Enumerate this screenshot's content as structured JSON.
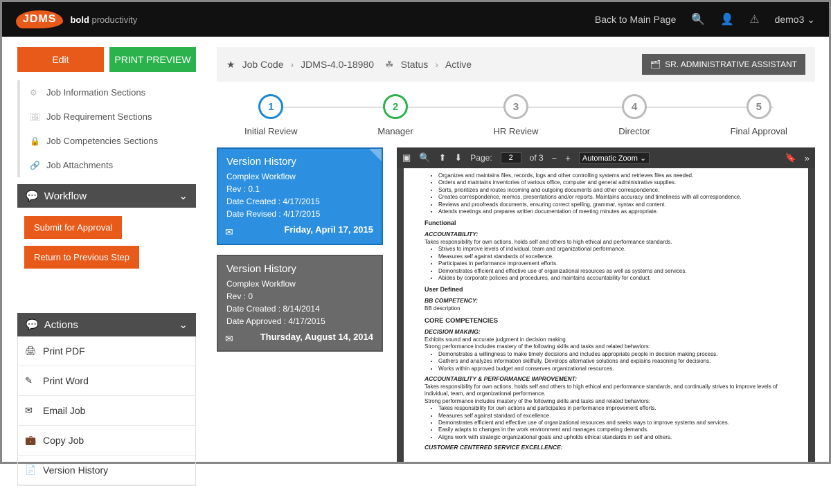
{
  "topbar": {
    "logo": "JDMS",
    "tagline_bold": "bold",
    "tagline_rest": " productivity",
    "back_link": "Back to Main Page",
    "user": "demo3"
  },
  "sidebar": {
    "edit": "Edit",
    "print_preview": "PRINT PREVIEW",
    "nav": [
      {
        "icon": "⚙",
        "label": "Job Information Sections"
      },
      {
        "icon": "🖼",
        "label": "Job Requirement Sections"
      },
      {
        "icon": "🔒",
        "label": "Job Competencies Sections"
      },
      {
        "icon": "🔗",
        "label": "Job Attachments"
      }
    ],
    "workflow": {
      "title": "Workflow",
      "submit": "Submit for Approval",
      "return": "Return to Previous Step"
    },
    "actions": {
      "title": "Actions",
      "items": [
        {
          "icon": "🖨",
          "label": "Print PDF"
        },
        {
          "icon": "✎",
          "label": "Print Word"
        },
        {
          "icon": "✉",
          "label": "Email Job"
        },
        {
          "icon": "💼",
          "label": "Copy Job"
        },
        {
          "icon": "📄",
          "label": "Version History"
        }
      ]
    }
  },
  "breadcrumb": {
    "jobcode_label": "Job Code",
    "jobcode": "JDMS-4.0-18980",
    "status_label": "Status",
    "status": "Active",
    "badge": "SR. ADMINISTRATIVE ASSISTANT"
  },
  "steps": [
    {
      "num": "1",
      "label": "Initial Review",
      "cls": "blue"
    },
    {
      "num": "2",
      "label": "Manager",
      "cls": "green"
    },
    {
      "num": "3",
      "label": "HR Review",
      "cls": ""
    },
    {
      "num": "4",
      "label": "Director",
      "cls": ""
    },
    {
      "num": "5",
      "label": "Final Approval",
      "cls": ""
    }
  ],
  "versions": [
    {
      "color": "blue",
      "title": "Version History",
      "workflow": "Complex Workflow",
      "rev": "Rev : 0.1",
      "created": "Date Created : 4/17/2015",
      "revised": "Date Revised : 4/17/2015",
      "date_big": "Friday, April 17, 2015"
    },
    {
      "color": "grey",
      "title": "Version History",
      "workflow": "Complex Workflow",
      "rev": "Rev : 0",
      "created": "Date Created : 8/14/2014",
      "revised": "Date Approved : 4/17/2015",
      "date_big": "Thursday, August 14, 2014"
    }
  ],
  "pdf": {
    "page_label": "Page:",
    "current": "2",
    "of": "of 3",
    "zoom": "Automatic Zoom",
    "content": {
      "top_bullets": [
        "Organizes and maintains files, records, logs and other controlling systems and retrieves files as needed.",
        "Orders and maintains inventories of various office, computer and general administrative supplies.",
        "Sorts, prioritizes and routes incoming and outgoing documents and other correspondence.",
        "Creates correspondence, memos, presentations and/or reports. Maintains accuracy and timeliness with all correspondence.",
        "Reviews and proofreads documents, ensuring correct spelling, grammar, syntax and content.",
        "Attends meetings and prepares written documentation of meeting minutes as appropriate."
      ],
      "functional": "Functional",
      "accountability_h": "ACCOUNTABILITY:",
      "accountability_intro": "Takes responsibility for own actions, holds self and others to high ethical and performance standards.",
      "accountability_bullets": [
        "Strives to improve levels of individual, team and organizational performance.",
        "Measures self against standards of excellence.",
        "Participates in performance improvement efforts.",
        "Demonstrates efficient and effective use of organizational resources as well as systems and services.",
        "Abides by corporate policies and procedures, and maintains accountability for conduct."
      ],
      "user_defined": "User Defined",
      "bb_comp_h": "BB COMPETENCY:",
      "bb_comp_txt": "BB description",
      "core_h": "CORE COMPETENCIES",
      "decision_h": "DECISION MAKING:",
      "decision_l1": "Exhibits sound and accurate judgment in decision making.",
      "decision_l2": "Strong performance includes mastery of the following skills and tasks and related behaviors:",
      "decision_bullets": [
        "Demonstrates a willingness to make timely decisions and includes appropriate people in decision making process.",
        "Gathers and analyzes information skillfully.  Develops alternative solutions and explains reasoning for decisions.",
        "Works within approved budget and conserves organizational resources."
      ],
      "api_h": "ACCOUNTABILITY & PERFORMANCE IMPROVEMENT:",
      "api_l1": "Takes responsibility for own actions, holds self and others to high ethical and performance standards, and continually strives to improve levels of individual, team, and organizational performance.",
      "api_l2": "Strong performance includes mastery of the following skills and tasks and related behaviors:",
      "api_bullets": [
        "Takes responsibility for own actions and participates in performance improvement efforts.",
        "Measures self against standard of excellence.",
        "Demonstrates efficient and effective use of organizational resources and seeks ways to improve systems and services.",
        "Easily adapts to changes in the work environment and manages competing demands.",
        "Aligns work with strategic organizational goals and upholds ethical standards in self and others."
      ],
      "ccse_h": "CUSTOMER CENTERED SERVICE EXCELLENCE:"
    }
  }
}
